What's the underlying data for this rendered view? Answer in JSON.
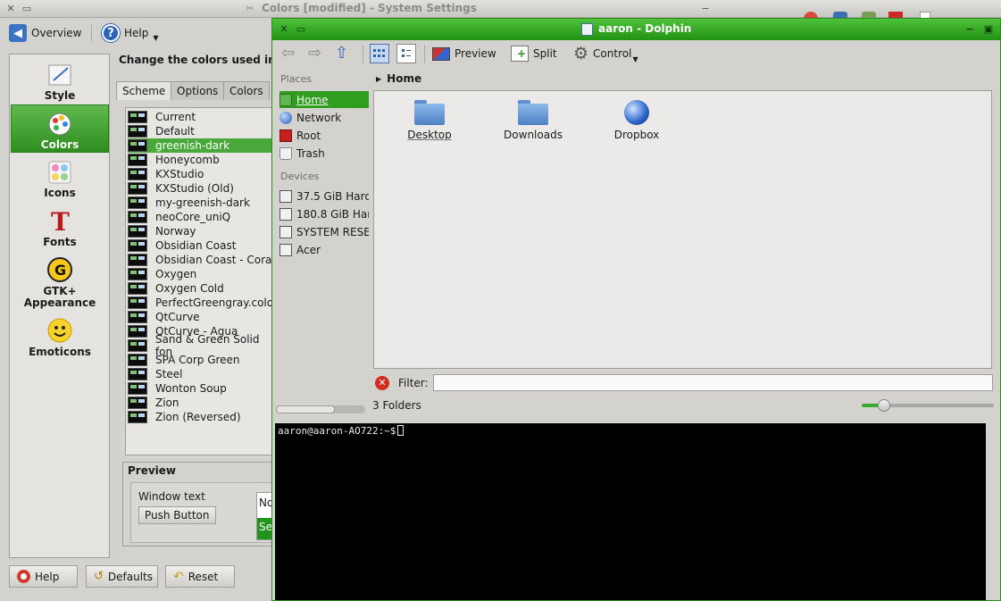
{
  "settings": {
    "title": "Colors [modified] - System Settings",
    "toolbar": {
      "overview": "Overview",
      "help": "Help"
    },
    "categories": [
      {
        "label": "Style",
        "icon": "style-icon"
      },
      {
        "label": "Colors",
        "icon": "colors-icon"
      },
      {
        "label": "Icons",
        "icon": "icons-icon"
      },
      {
        "label": "Fonts",
        "icon": "fonts-icon"
      },
      {
        "label": "GTK+ Appearance",
        "icon": "gtk-icon"
      },
      {
        "label": "Emoticons",
        "icon": "emoticons-icon"
      }
    ],
    "heading": "Change the colors used in",
    "tabs": [
      "Scheme",
      "Options",
      "Colors"
    ],
    "schemes": [
      "Current",
      "Default",
      "greenish-dark",
      "Honeycomb",
      "KXStudio",
      "KXStudio (Old)",
      "my-greenish-dark",
      "neoCore_uniQ",
      "Norway",
      "Obsidian Coast",
      "Obsidian Coast - Coral",
      "Oxygen",
      "Oxygen Cold",
      "PerfectGreengray.color",
      "QtCurve",
      "QtCurve - Agua",
      "Sand & Green Solid fon",
      "SPA Corp Green",
      "Steel",
      "Wonton Soup",
      "Zion",
      "Zion (Reversed)"
    ],
    "selected_scheme": "greenish-dark",
    "preview": {
      "title": "Preview",
      "window_text": "Window text",
      "push_button": "Push Button",
      "cut_normal": "No",
      "cut_selected": "Se"
    },
    "bottom_buttons": {
      "help": "Help",
      "defaults": "Defaults",
      "reset": "Reset"
    }
  },
  "dolphin": {
    "title": "aaron - Dolphin",
    "toolbar": {
      "preview": "Preview",
      "split": "Split",
      "control": "Control"
    },
    "places_header": "Places",
    "places": [
      {
        "label": "Home",
        "icon": "home-folder-icon"
      },
      {
        "label": "Network",
        "icon": "network-icon"
      },
      {
        "label": "Root",
        "icon": "root-folder-icon"
      },
      {
        "label": "Trash",
        "icon": "trash-icon"
      }
    ],
    "devices_header": "Devices",
    "devices": [
      {
        "label": "37.5 GiB Hard",
        "icon": "hard-drive-icon"
      },
      {
        "label": "180.8 GiB Har",
        "icon": "hard-drive-icon"
      },
      {
        "label": "SYSTEM RESE",
        "icon": "drive-icon"
      },
      {
        "label": "Acer",
        "icon": "drive-icon"
      }
    ],
    "breadcrumb": "Home",
    "files": [
      {
        "label": "Desktop",
        "icon": "folder-icon"
      },
      {
        "label": "Downloads",
        "icon": "folder-icon"
      },
      {
        "label": "Dropbox",
        "icon": "dropbox-globe-icon"
      }
    ],
    "filter_label": "Filter:",
    "filter_value": "",
    "status": "3 Folders",
    "zoom_fraction": 0.17,
    "places_scroll_fraction": 0.66,
    "terminal_prompt": "aaron@aaron-AO722:~$"
  },
  "colors": {
    "accent": "#2f9e1f",
    "terminal_bg": "#000000"
  }
}
